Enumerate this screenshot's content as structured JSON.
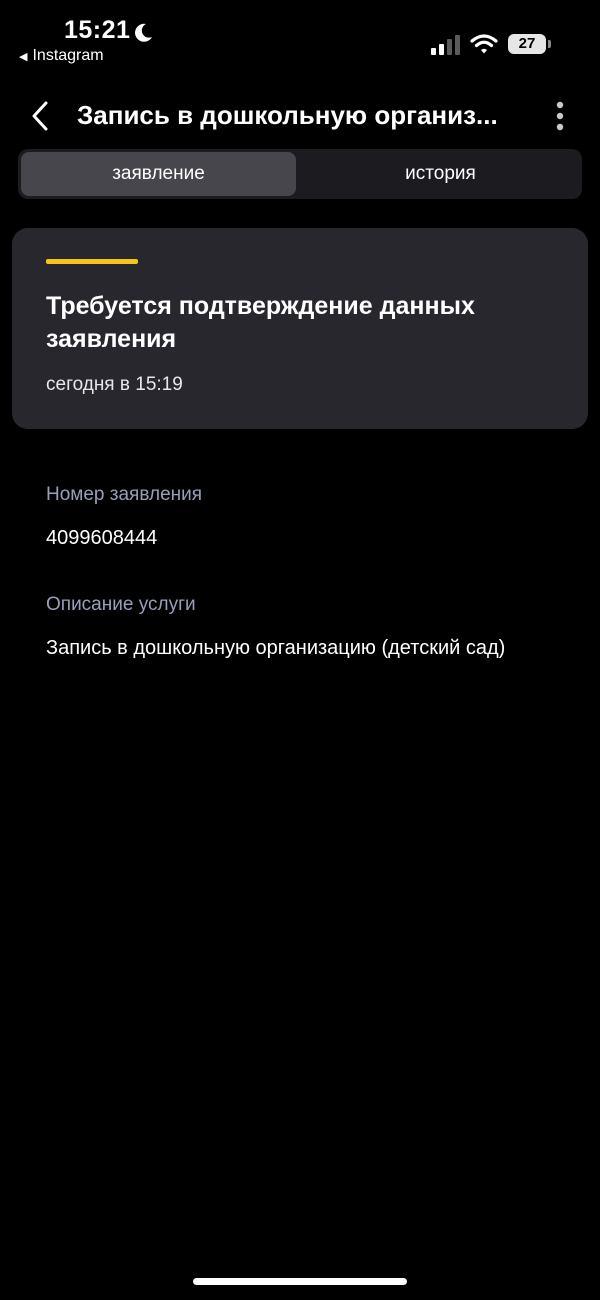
{
  "status_bar": {
    "time": "15:21",
    "back_app": "Instagram",
    "battery": "27"
  },
  "nav": {
    "title": "Запись в дошкольную организ..."
  },
  "tabs": [
    {
      "label": "заявление",
      "active": true
    },
    {
      "label": "история",
      "active": false
    }
  ],
  "status_card": {
    "title": "Требуется подтверждение данных заявления",
    "date": "сегодня в 15:19",
    "accent_color": "#f5c518"
  },
  "fields": {
    "application_number": {
      "label": "Номер заявления",
      "value": "4099608444"
    },
    "service_description": {
      "label": "Описание услуги",
      "value": "Запись в дошкольную организацию (детский сад)"
    }
  },
  "icons": {
    "moon": "moon-icon",
    "signal": "cellular-signal-icon",
    "wifi": "wifi-icon",
    "back": "chevron-left-icon",
    "menu": "more-vertical-icon"
  }
}
